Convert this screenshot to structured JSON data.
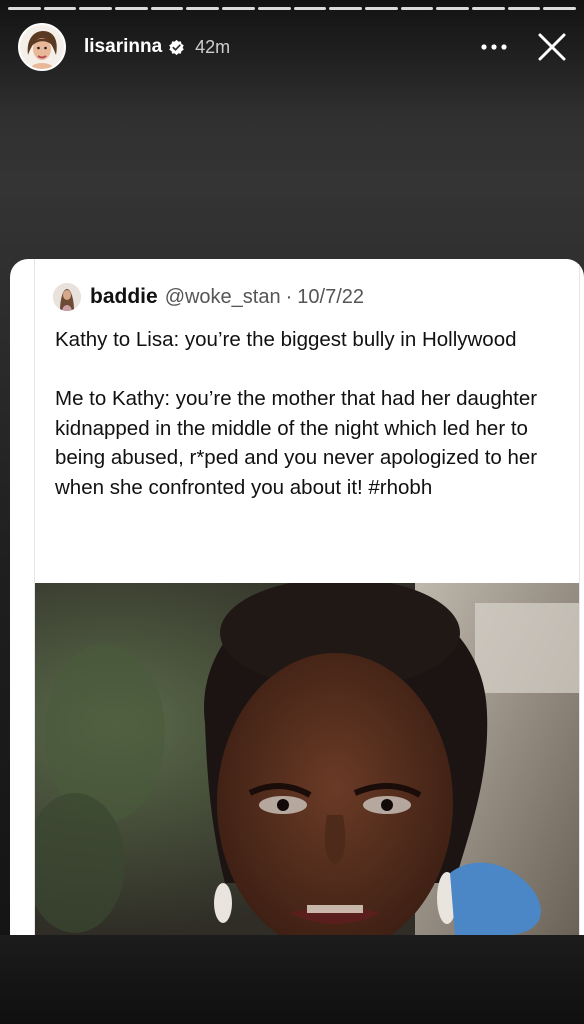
{
  "story": {
    "progress_segments": 16,
    "progress_active_index": 15,
    "username": "lisarinna",
    "verified": true,
    "time": "42m",
    "more_icon": "more-horizontal-icon",
    "close_icon": "close-icon"
  },
  "tweet": {
    "display_name": "baddie",
    "handle": "@woke_stan",
    "separator": "·",
    "date": "10/7/22",
    "paragraph_1": "Kathy to Lisa: you’re the biggest bully in Hollywood",
    "paragraph_2": "Me to Kathy: you’re the mother that had her daughter kidnapped in the middle of the night which led her to being abused, r*ped and you never apologized to her when she confronted you about it! #rhobh"
  },
  "colors": {
    "story_background": "#2a2a2a",
    "card_background": "#ffffff",
    "text_primary": "#111111",
    "text_secondary": "#555555"
  }
}
